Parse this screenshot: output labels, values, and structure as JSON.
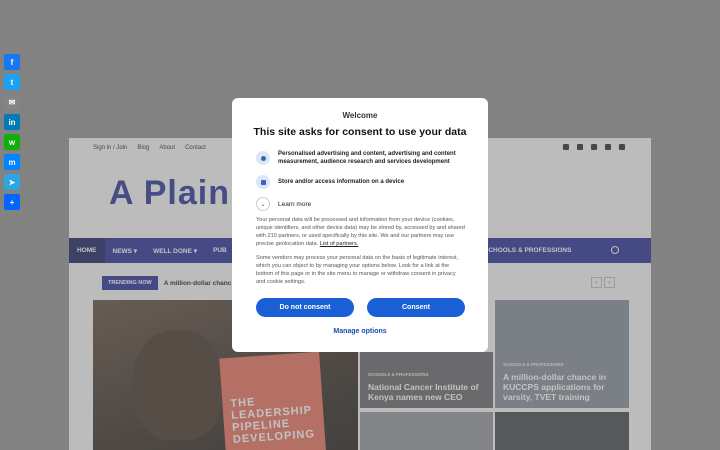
{
  "page": {
    "top_links": [
      "Sign in / Join",
      "Blog",
      "About",
      "Contact"
    ],
    "logo_text": "A Plain",
    "nav": [
      "HOME",
      "NEWS ▾",
      "WELL DONE ▾",
      "PUB"
    ],
    "nav_right": "SCHOOLS & PROFESSIONS",
    "trending_label": "TRENDING NOW",
    "trending_text": "A million-dollar chanc",
    "book_text": "THE LEADERSHIP PIPELINE DEVELOPING",
    "cards": [
      {
        "category": "SCHOOLS & PROFESSIONS",
        "title": "A million-dollar chance in KUCCPS applications for varsity, TVET training"
      },
      {
        "category": "SCHOOLS & PROFESSIONS",
        "title": "National Cancer Institute of Kenya names new CEO"
      }
    ]
  },
  "share": [
    {
      "name": "facebook-icon",
      "glyph": "f",
      "color": "#1877f2"
    },
    {
      "name": "twitter-icon",
      "glyph": "t",
      "color": "#1da1f2"
    },
    {
      "name": "email-icon",
      "glyph": "✉",
      "color": "#848484"
    },
    {
      "name": "linkedin-icon",
      "glyph": "in",
      "color": "#007bb5"
    },
    {
      "name": "whatsapp-icon",
      "glyph": "w",
      "color": "#12af0a"
    },
    {
      "name": "messenger-icon",
      "glyph": "m",
      "color": "#0084ff"
    },
    {
      "name": "telegram-icon",
      "glyph": "➤",
      "color": "#2ca5e0"
    },
    {
      "name": "share-icon",
      "glyph": "+",
      "color": "#0166ff"
    }
  ],
  "consent": {
    "welcome": "Welcome",
    "heading": "This site asks for consent to use your data",
    "purposes": [
      "Personalised advertising and content, advertising and content measurement, audience research and services development",
      "Store and/or access information on a device"
    ],
    "learn_more": "Learn more",
    "body1": "Your personal data will be processed and information from your device (cookies, unique identifiers, and other device data) may be stored by, accessed by and shared with 210 partners, or used specifically by this site. We and our partners may use precise geolocation data.",
    "partners_link": "List of partners.",
    "body2": "Some vendors may process your personal data on the basis of legitimate interest, which you can object to by managing your options below. Look for a link at the bottom of this page or in the site menu to manage or withdraw consent in privacy and cookie settings.",
    "do_not_consent": "Do not consent",
    "consent_btn": "Consent",
    "manage": "Manage options"
  }
}
